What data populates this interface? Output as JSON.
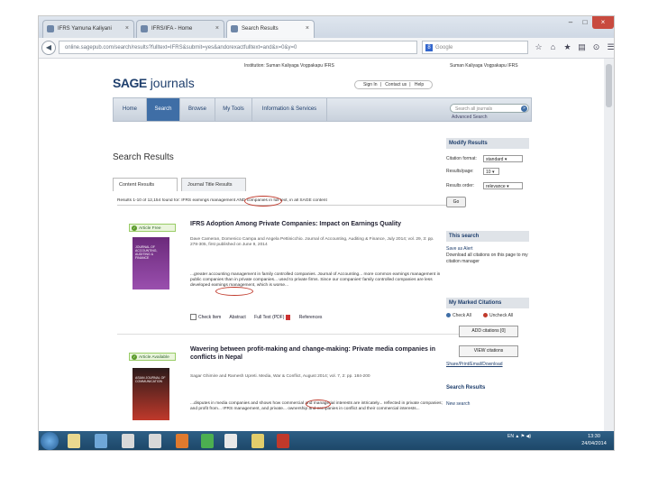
{
  "browser": {
    "tabs": [
      {
        "label": "IFRS Yamuna Kaliyani",
        "close": "×"
      },
      {
        "label": "IFRS/IFA - Home",
        "close": "×"
      },
      {
        "label": "Search Results",
        "close": "×"
      }
    ],
    "window_buttons": [
      "–",
      "□",
      "×"
    ],
    "back": "◀",
    "url": "online.sagepub.com/search/results?fulltext=IFRS&submit=yes&andorexactfulltext=and&x=0&y=0",
    "search_placeholder": "Google",
    "search_engine": "8",
    "nav_icons": [
      "☆",
      "⌂",
      "★",
      "▤",
      "⊙",
      "☰"
    ]
  },
  "header": {
    "institution": "Institution: Suman Kaliyaga Vogpakapu IFRS",
    "user": "Suman Kaliyaga Vogpakapu IFRS",
    "logo_sage": "SAGE",
    "logo_journals": "journals",
    "toplinks": [
      "Sign In",
      "Contact us",
      "Help"
    ],
    "nav": [
      "Home",
      "Search",
      "Browse",
      "My Tools",
      "Information & Services"
    ],
    "journal_search_placeholder": "Search all journals",
    "go": "»",
    "advanced_search": "Advanced Search"
  },
  "results": {
    "heading": "Search Results",
    "tabs": [
      "Content Results",
      "Journal Title Results"
    ],
    "summary": "Results 1-10 of 12,154 found for: IFRS earnings management AND companies in full text, in all SAGE content",
    "items": [
      {
        "badge": "Article Free",
        "cover_text": "JOURNAL OF ACCOUNTING, AUDITING & FINANCE",
        "title": "IFRS Adoption Among Private Companies: Impact on Earnings Quality",
        "meta": "Dave Cameran, Domenico Campa and Angela Pettinicchio. Journal of Accounting, Auditing & Finance, July 2014; vol. 29, 3: pp. 278-305, first published on June 9, 2014",
        "snippet": "...greater accounting management in family controlled companies. Journal of Accounting... more common earnings management in public companies than in private companies... used to private firms. Since our companies' family controlled companies are less developed earnings management, which is worse...",
        "actions": [
          "Check Item",
          "Abstract",
          "Full Text (PDF)",
          "References"
        ]
      },
      {
        "badge": "Article Available",
        "cover_text": "ASIAN JOURNAL OF COMMUNICATION",
        "title": "Wavering between profit-making and change-making: Private media companies in conflicts in Nepal",
        "meta": "Sagar Ghimire and Ramesh Upreti. Media, War & Conflict, August 2014; vol. 7, 2: pp. 184-200",
        "snippet": "...disputes in media companies and shows how commercial and managerial interests are intricately... reflected in private companies; and profit from... IFRS management, and private... ownership and companies in conflict and their commercial interests...",
        "actions": []
      }
    ]
  },
  "sidebar": {
    "modify_title": "Modify Results",
    "rows": [
      {
        "label": "Citation format:",
        "value": "standard"
      },
      {
        "label": "Results/page:",
        "value": "10"
      },
      {
        "label": "Results order:",
        "value": "relevance"
      }
    ],
    "go": "Go",
    "this_search_title": "This search",
    "save_alert": "Save as Alert",
    "download_text": "Download all citations on this page to my citation manager",
    "marked_title": "My Marked Citations",
    "check_all": "Check All",
    "uncheck_all": "Uncheck All",
    "add_citations": "ADD citations [0]",
    "view_citations": "VIEW citations",
    "share": "Share/Print/Email/Download",
    "search_results_title": "Search Results",
    "new_search": "New search"
  },
  "taskbar": {
    "tray": "EN  ▲  ⚑  ◀)",
    "time": "13:30",
    "date": "24/04/2014"
  },
  "colors": {
    "accent": "#3f6ea6",
    "brand": "#1f3f6d",
    "taskbar": "#1b4566",
    "annotation": "#c0392b"
  }
}
